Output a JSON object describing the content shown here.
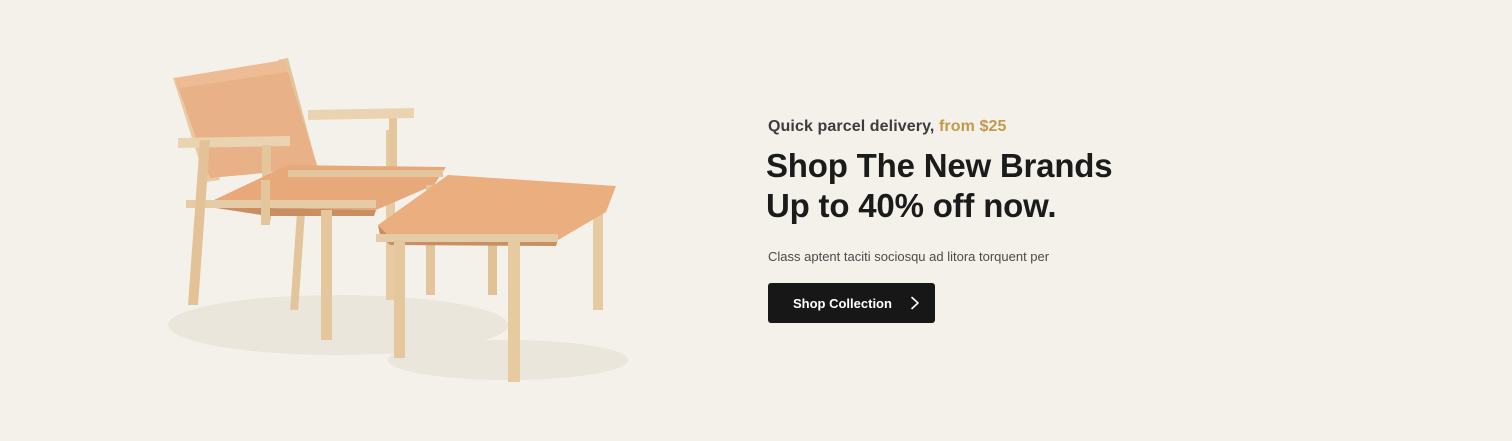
{
  "banner": {
    "kicker_text": "Quick parcel delivery, ",
    "kicker_accent": "from $25",
    "headline_line1": "Shop The New Brands",
    "headline_line2": "Up to 40% off now.",
    "subtext": "Class aptent taciti sociosqu ad litora torquent per",
    "cta_label": "Shop Collection",
    "cta_icon": "chevron-right-icon",
    "image": "lounge-chair-and-ottoman"
  },
  "colors": {
    "background": "#f4f1ea",
    "accent": "#c19a4a",
    "button": "#171717",
    "leather": "#e7ad80",
    "wood": "#e9cfa9"
  }
}
